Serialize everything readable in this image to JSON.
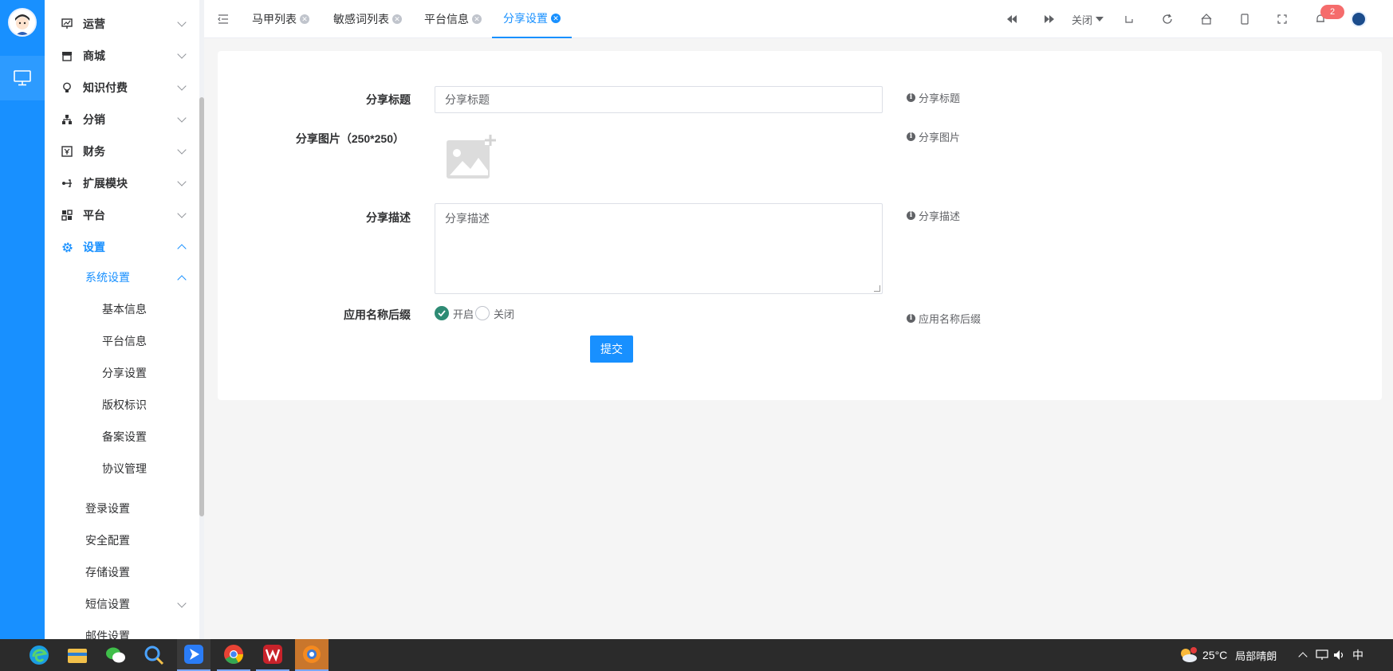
{
  "sidebar": {
    "menus": [
      {
        "label": "运营",
        "icon": "chart-board-icon"
      },
      {
        "label": "商城",
        "icon": "store-icon"
      },
      {
        "label": "知识付费",
        "icon": "lightbulb-icon"
      },
      {
        "label": "分销",
        "icon": "org-tree-icon"
      },
      {
        "label": "财务",
        "icon": "finance-icon"
      },
      {
        "label": "扩展模块",
        "icon": "extension-icon"
      },
      {
        "label": "平台",
        "icon": "platform-icon"
      },
      {
        "label": "设置",
        "icon": "gear-icon"
      }
    ],
    "system_settings": "系统设置",
    "system_children": [
      "基本信息",
      "平台信息",
      "分享设置",
      "版权标识",
      "备案设置",
      "协议管理"
    ],
    "other_settings": [
      "登录设置",
      "安全配置",
      "存储设置",
      "短信设置",
      "邮件设置"
    ]
  },
  "tabs": [
    {
      "label": "马甲列表"
    },
    {
      "label": "敏感词列表"
    },
    {
      "label": "平台信息"
    },
    {
      "label": "分享设置",
      "active": true
    }
  ],
  "toolbar": {
    "close_label": "关闭",
    "notification_count": "2"
  },
  "form": {
    "title_label": "分享标题",
    "title_value": "分享标题",
    "title_help": "分享标题",
    "image_label": "分享图片（250*250）",
    "image_help": "分享图片",
    "desc_label": "分享描述",
    "desc_value": "分享描述",
    "desc_help": "分享描述",
    "suffix_label": "应用名称后缀",
    "suffix_on": "开启",
    "suffix_off": "关闭",
    "suffix_selected": "开启",
    "suffix_help": "应用名称后缀",
    "submit": "提交"
  },
  "taskbar": {
    "weather_temp": "25°C",
    "weather_desc": "局部晴朗",
    "ime": "中"
  },
  "colors": {
    "primary": "#1890ff",
    "radio_checked": "#2e8b74",
    "badge": "#f56c6c"
  }
}
